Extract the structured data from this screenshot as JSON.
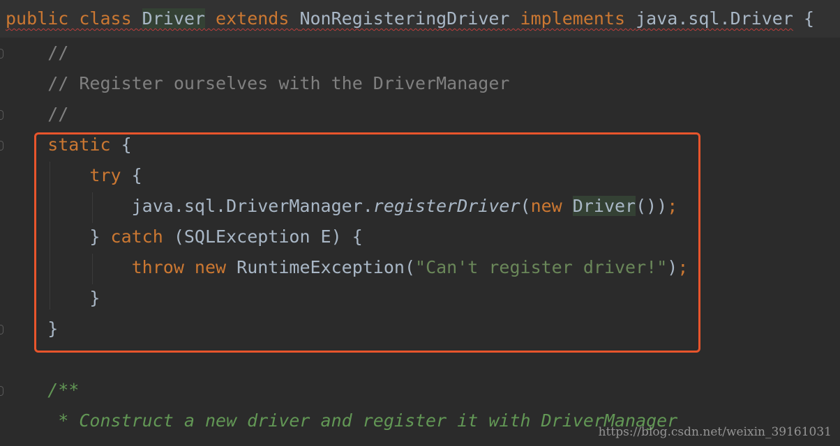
{
  "editor": {
    "lines": [
      {
        "id": "class-decl",
        "tokens": [
          {
            "t": "public class ",
            "c": "kw squig"
          },
          {
            "t": "Driver",
            "c": "plain hl squig"
          },
          {
            "t": " extends ",
            "c": "kw squig"
          },
          {
            "t": "NonRegisteringDriver",
            "c": "plain squig"
          },
          {
            "t": " implements ",
            "c": "kw squig"
          },
          {
            "t": "java.sql.Driver",
            "c": "plain squig"
          },
          {
            "t": " {",
            "c": "plain"
          }
        ]
      },
      {
        "id": "comment-1",
        "tokens": [
          {
            "t": "    //",
            "c": "cm"
          }
        ]
      },
      {
        "id": "comment-2",
        "tokens": [
          {
            "t": "    // Register ourselves with the DriverManager",
            "c": "cm"
          }
        ]
      },
      {
        "id": "comment-3",
        "tokens": [
          {
            "t": "    //",
            "c": "cm"
          }
        ]
      },
      {
        "id": "static-open",
        "tokens": [
          {
            "t": "    static",
            "c": "kw"
          },
          {
            "t": " {",
            "c": "plain"
          }
        ]
      },
      {
        "id": "try-open",
        "tokens": [
          {
            "t": "        try",
            "c": "kw"
          },
          {
            "t": " {",
            "c": "plain"
          }
        ]
      },
      {
        "id": "register-call",
        "tokens": [
          {
            "t": "            java.sql.DriverManager.",
            "c": "plain"
          },
          {
            "t": "registerDriver",
            "c": "plain ital"
          },
          {
            "t": "(",
            "c": "plain"
          },
          {
            "t": "new ",
            "c": "kw"
          },
          {
            "t": "Driver",
            "c": "plain hl"
          },
          {
            "t": "())",
            "c": "plain"
          },
          {
            "t": ";",
            "c": "kw"
          }
        ]
      },
      {
        "id": "catch-line",
        "tokens": [
          {
            "t": "        } ",
            "c": "plain"
          },
          {
            "t": "catch",
            "c": "kw"
          },
          {
            "t": " (SQLException E) {",
            "c": "plain"
          }
        ]
      },
      {
        "id": "throw-line",
        "tokens": [
          {
            "t": "            throw new ",
            "c": "kw"
          },
          {
            "t": "RuntimeException(",
            "c": "plain"
          },
          {
            "t": "\"Can't register driver!\"",
            "c": "str"
          },
          {
            "t": ")",
            "c": "plain"
          },
          {
            "t": ";",
            "c": "kw"
          }
        ]
      },
      {
        "id": "catch-close",
        "tokens": [
          {
            "t": "        }",
            "c": "plain"
          }
        ]
      },
      {
        "id": "static-close",
        "tokens": [
          {
            "t": "    }",
            "c": "plain"
          }
        ]
      },
      {
        "id": "blank",
        "tokens": [
          {
            "t": "",
            "c": "plain"
          }
        ]
      },
      {
        "id": "javadoc-open",
        "tokens": [
          {
            "t": "    /**",
            "c": "doc"
          }
        ]
      },
      {
        "id": "javadoc-text",
        "tokens": [
          {
            "t": "     * Construct a new driver and register it with DriverManager",
            "c": "doc"
          }
        ]
      }
    ]
  },
  "watermark": "https://blog.csdn.net/weixin_39161031",
  "colors": {
    "background": "#2b2b2b",
    "keyword": "#cc7832",
    "identifier": "#a9b7c6",
    "comment": "#808080",
    "doc_comment": "#629755",
    "string": "#6a8759",
    "highlight_box": "#e8552c"
  }
}
